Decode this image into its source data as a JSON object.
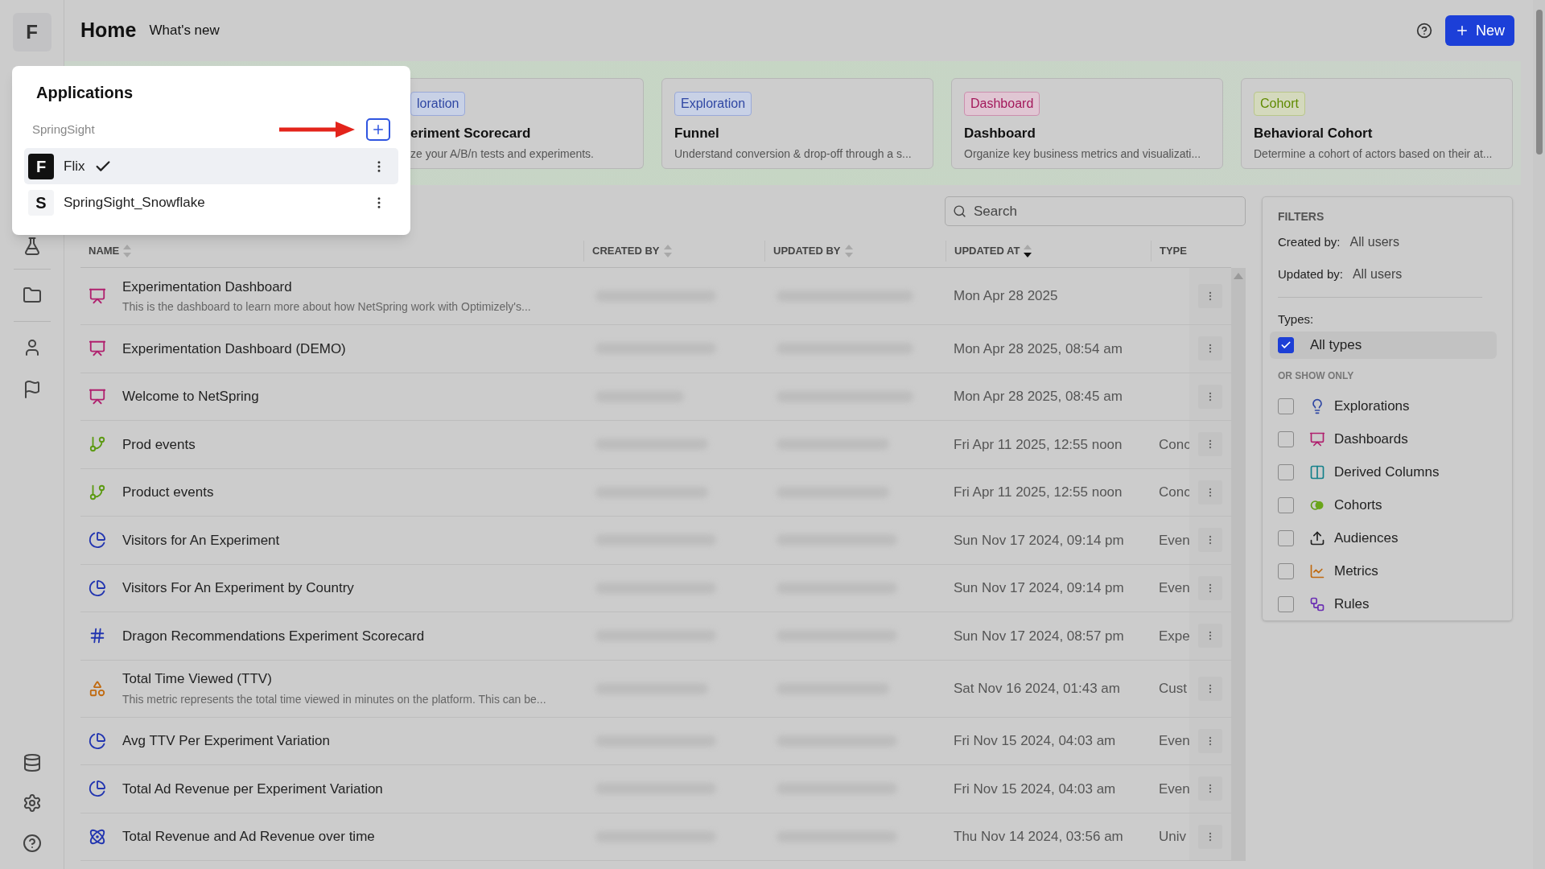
{
  "rail": {
    "logo": "F"
  },
  "header": {
    "title": "Home",
    "link": "What's new",
    "new_button": "New"
  },
  "cards": [
    {
      "kind": "exploration",
      "badge": "loration",
      "title": "eriment Scorecard",
      "description": "ze your A/B/n tests and experiments.",
      "partial": true
    },
    {
      "kind": "exploration",
      "badge": "Exploration",
      "title": "Funnel",
      "description": "Understand conversion & drop-off through a s...",
      "partial": false
    },
    {
      "kind": "dashboard",
      "badge": "Dashboard",
      "title": "Dashboard",
      "description": "Organize key business metrics and visualizati...",
      "partial": false
    },
    {
      "kind": "cohort",
      "badge": "Cohort",
      "title": "Behavioral Cohort",
      "description": "Determine a cohort of actors based on their at...",
      "partial": false
    }
  ],
  "search": {
    "placeholder": "Search"
  },
  "table": {
    "columns": [
      {
        "label": "NAME",
        "sorted_desc": false
      },
      {
        "label": "CREATED BY",
        "sorted_desc": false
      },
      {
        "label": "UPDATED BY",
        "sorted_desc": false
      },
      {
        "label": "UPDATED AT",
        "sorted_desc": true
      },
      {
        "label": "TYPE"
      }
    ],
    "rows": [
      {
        "kind": "dashboard",
        "name": "Experimentation Dashboard",
        "description": "This is the dashboard to learn more about how NetSpring work with Optimizely's...",
        "updated_at": "Mon Apr 28 2025"
      },
      {
        "kind": "dashboard",
        "name": "Experimentation Dashboard (DEMO)",
        "updated_at": "Mon Apr 28 2025, 08:54 am"
      },
      {
        "kind": "dashboard",
        "name": "Welcome to NetSpring",
        "updated_at": "Mon Apr 28 2025, 08:45 am"
      },
      {
        "kind": "event",
        "name": "Prod events",
        "updated_at": "Fri Apr 11 2025, 12:55 noon",
        "type": "Conc"
      },
      {
        "kind": "event",
        "name": "Product events",
        "updated_at": "Fri Apr 11 2025, 12:55 noon",
        "type": "Conc"
      },
      {
        "kind": "pie",
        "name": "Visitors for An Experiment",
        "updated_at": "Sun Nov 17 2024, 09:14 pm",
        "type": "Even"
      },
      {
        "kind": "pie",
        "name": "Visitors For An Experiment by Country",
        "updated_at": "Sun Nov 17 2024, 09:14 pm",
        "type": "Even"
      },
      {
        "kind": "scorecard",
        "name": "Dragon Recommendations Experiment Scorecard",
        "updated_at": "Sun Nov 17 2024, 08:57 pm",
        "type": "Expe"
      },
      {
        "kind": "metric",
        "name": "Total Time Viewed (TTV)",
        "description": "This metric represents the total time viewed in minutes on the platform. This can be...",
        "updated_at": "Sat Nov 16 2024, 01:43 am",
        "type": "Cust"
      },
      {
        "kind": "pie",
        "name": "Avg TTV Per Experiment Variation",
        "updated_at": "Fri Nov 15 2024, 04:03 am",
        "type": "Even"
      },
      {
        "kind": "pie",
        "name": "Total Ad Revenue per Experiment Variation",
        "updated_at": "Fri Nov 15 2024, 04:03 am",
        "type": "Even"
      },
      {
        "kind": "atom",
        "name": "Total Revenue and Ad Revenue over time",
        "updated_at": "Thu Nov 14 2024, 03:56 am",
        "type": "Univ"
      }
    ]
  },
  "filters": {
    "title": "FILTERS",
    "created_by": {
      "label": "Created by:",
      "value": "All users"
    },
    "updated_by": {
      "label": "Updated by:",
      "value": "All users"
    },
    "types_label": "Types:",
    "all_types": {
      "label": "All types",
      "checked": true
    },
    "subheading": "OR SHOW ONLY",
    "types": [
      {
        "kind": "explorations",
        "label": "Explorations",
        "checked": false
      },
      {
        "kind": "dashboards",
        "label": "Dashboards",
        "checked": false
      },
      {
        "kind": "derived",
        "label": "Derived Columns",
        "checked": false
      },
      {
        "kind": "cohorts",
        "label": "Cohorts",
        "checked": false
      },
      {
        "kind": "audiences",
        "label": "Audiences",
        "checked": false
      },
      {
        "kind": "metrics",
        "label": "Metrics",
        "checked": false
      },
      {
        "kind": "rules",
        "label": "Rules",
        "checked": false
      }
    ]
  },
  "popover": {
    "title": "Applications",
    "group": "SpringSight",
    "apps": [
      {
        "initial": "F",
        "name": "Flix",
        "color": "#111111",
        "selected": true
      },
      {
        "initial": "S",
        "name": "SpringSight_Snowflake",
        "color": "#f3f4f6",
        "selected": false
      }
    ]
  }
}
